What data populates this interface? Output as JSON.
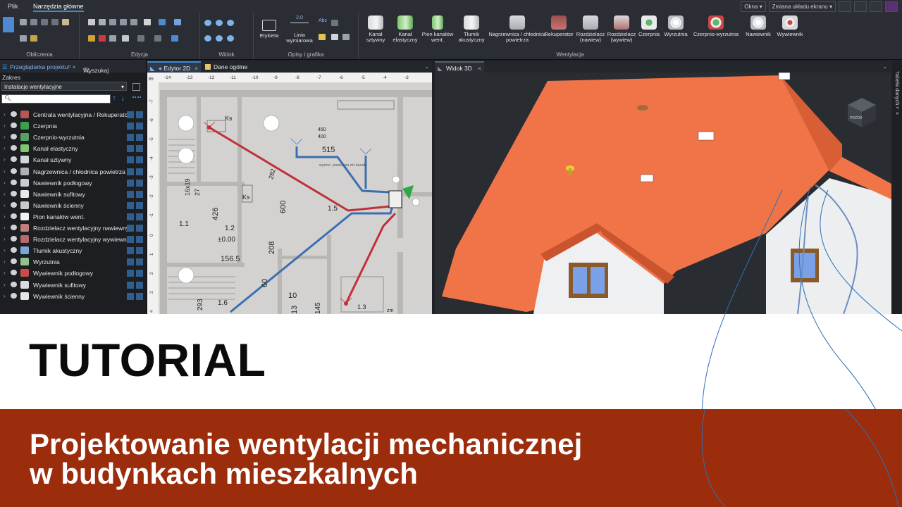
{
  "menu": {
    "file": "Plik",
    "main_tools": "Narzędzia główne"
  },
  "window_controls": {
    "windows": "Okna",
    "layout": "Zmiana układu ekranu"
  },
  "ribbon": {
    "groups": [
      "Obliczenia",
      "Edycja",
      "Widok",
      "Opisy i grafika",
      "Wentylacja"
    ],
    "labels_tool": "Etykieta",
    "dimension_tool": "Linia wymiarowa",
    "dimension_value": "2,0",
    "text_tool": "Abc",
    "vent_buttons": [
      {
        "label": "Kanał sztywny",
        "icon": "rigid-duct-icon"
      },
      {
        "label": "Kanał elastyczny",
        "icon": "flexible-duct-icon"
      },
      {
        "label": "Pion kanałów went.",
        "icon": "duct-riser-icon"
      },
      {
        "label": "Tłumik akustyczny",
        "icon": "silencer-icon"
      },
      {
        "label": "Nagrzewnica / chłodnica powietrza",
        "icon": "heater-cooler-icon"
      },
      {
        "label": "Rekuperator",
        "icon": "recuperator-icon"
      },
      {
        "label": "Rozdzielacz (nawiew)",
        "icon": "supply-distributor-icon"
      },
      {
        "label": "Rozdzielacz (wywiew)",
        "icon": "exhaust-distributor-icon"
      },
      {
        "label": "Czerpnia",
        "icon": "air-intake-icon"
      },
      {
        "label": "Wyrzutnia",
        "icon": "air-outlet-icon"
      },
      {
        "label": "Czerpnio-wyrzutnia",
        "icon": "intake-outlet-icon"
      },
      {
        "label": "Nawiewnik",
        "icon": "supply-diffuser-icon"
      },
      {
        "label": "Wywiewnik",
        "icon": "exhaust-diffuser-icon"
      }
    ]
  },
  "project_panel": {
    "tab_browser": "Przeglądarka projektu",
    "tab_search": "Wyszukaj",
    "scope_label": "Zakres",
    "scope_value": "Instalacje wentylacyjne",
    "items": [
      {
        "label": "Centrala wentylacyjna / Rekuperator",
        "color": "#b65656"
      },
      {
        "label": "Czerpnia",
        "color": "#3aa04c"
      },
      {
        "label": "Czerpnio-wyrzutnia",
        "color": "#5aa060"
      },
      {
        "label": "Kanał elastyczny",
        "color": "#7fc66f"
      },
      {
        "label": "Kanał sztywny",
        "color": "#d3d6d9"
      },
      {
        "label": "Nagrzewnica / chłodnica powietrza",
        "color": "#aeb2b7"
      },
      {
        "label": "Nawiewnik podłogowy",
        "color": "#c9ccd0"
      },
      {
        "label": "Nawiewnik sufitowy",
        "color": "#e6e8ea"
      },
      {
        "label": "Nawiewnik ścienny",
        "color": "#c7cacd"
      },
      {
        "label": "Pion kanałów went.",
        "color": "#f2f2f2"
      },
      {
        "label": "Rozdzielacz wentylacyjny nawiewny",
        "color": "#c27d7d"
      },
      {
        "label": "Rozdzielacz wentylacyjny wywiewny",
        "color": "#b86a6a"
      },
      {
        "label": "Tłumik akustyczny",
        "color": "#7aa6d8"
      },
      {
        "label": "Wyrzutnia",
        "color": "#8fc28a"
      },
      {
        "label": "Wywiewnik podłogowy",
        "color": "#c94b4b"
      },
      {
        "label": "Wywiewnik sufitowy",
        "color": "#d9dbdd"
      },
      {
        "label": "Wywiewnik ścienny",
        "color": "#e6e6e6"
      }
    ]
  },
  "editor2d": {
    "tab_editor": "Edytor 2D",
    "tab_general": "Dane ogólne",
    "ruler_top": [
      "-14",
      "-13",
      "-12",
      "-11",
      "-10",
      "-9",
      "-8",
      "-7",
      "-6",
      "-5",
      "-4",
      "-3"
    ],
    "ruler_left": [
      "-7",
      "-6",
      "-5",
      "-4",
      "-3",
      "-2",
      "-1",
      "0",
      "1",
      "2",
      "3",
      "4"
    ],
    "ruler_corner": "65",
    "plan_texts": {
      "ks_top": "Ks",
      "ks_mid": "Ks",
      "dim_515": "515",
      "dim_450": "450",
      "dim_400": "400",
      "dim_426": "426",
      "dim_600": "600",
      "dim_208": "208",
      "dim_60": "60",
      "dim_282": "282",
      "dim_1619": "16x19",
      "dim_27": "27",
      "dim_293": "293",
      "dim_145": "145",
      "room_11": "1.1",
      "room_12": "1.2",
      "level": "±0.00",
      "dim_1565": "156.5",
      "room_15": "1.5",
      "room_16": "1.6",
      "room_13": "1.3",
      "room_10": "10",
      "dim_13": "13",
      "zm": "zm",
      "note": "wyrzut. powietrza do kanału"
    }
  },
  "view3d": {
    "tab": "Widok 3D",
    "nav_cube": "PRZÓD",
    "side_panel": "Tabela danych"
  },
  "hero": {
    "title": "TUTORIAL",
    "subtitle_line1": "Projektowanie wentylacji mechanicznej",
    "subtitle_line2": "w budynkach mieszkalnych"
  }
}
